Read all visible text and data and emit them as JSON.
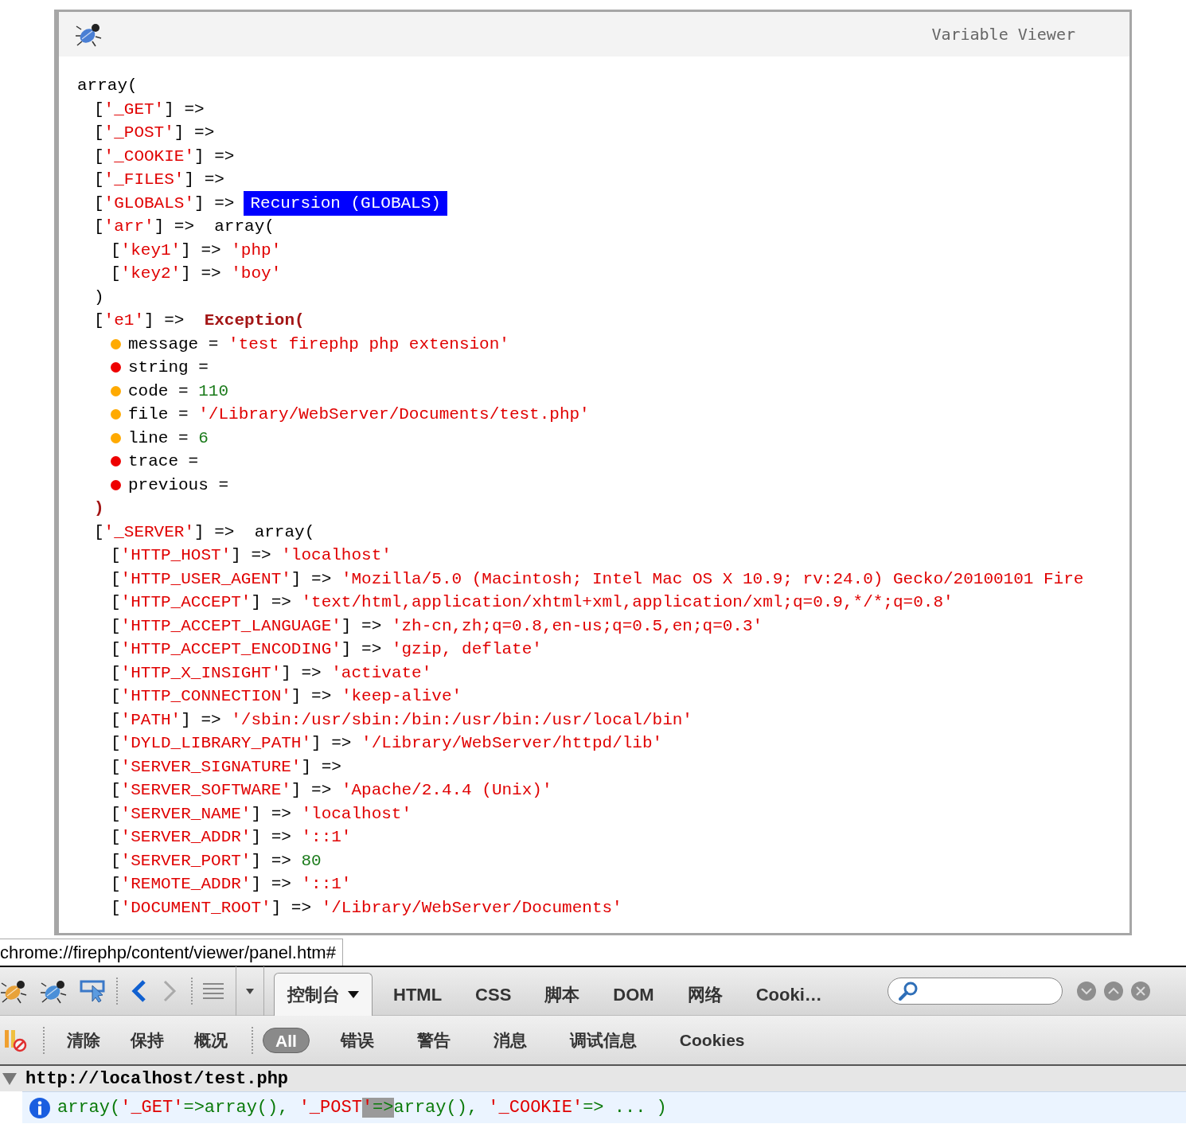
{
  "viewer": {
    "title": "Variable Viewer",
    "tree": {
      "line": [
        {
          "kind": "plain",
          "text": "array("
        }
      ],
      "children": [
        {
          "line": [
            {
              "kind": "plain",
              "text": "["
            },
            {
              "kind": "key",
              "text": "'_GET'"
            },
            {
              "kind": "plain",
              "text": "] =>"
            }
          ]
        },
        {
          "line": [
            {
              "kind": "plain",
              "text": "["
            },
            {
              "kind": "key",
              "text": "'_POST'"
            },
            {
              "kind": "plain",
              "text": "] =>"
            }
          ]
        },
        {
          "line": [
            {
              "kind": "plain",
              "text": "["
            },
            {
              "kind": "key",
              "text": "'_COOKIE'"
            },
            {
              "kind": "plain",
              "text": "] =>"
            }
          ]
        },
        {
          "line": [
            {
              "kind": "plain",
              "text": "["
            },
            {
              "kind": "key",
              "text": "'_FILES'"
            },
            {
              "kind": "plain",
              "text": "] =>"
            }
          ]
        },
        {
          "line": [
            {
              "kind": "plain",
              "text": "["
            },
            {
              "kind": "key",
              "text": "'GLOBALS'"
            },
            {
              "kind": "plain",
              "text": "] =>"
            },
            {
              "kind": "recursion",
              "text": "Recursion (GLOBALS)"
            }
          ]
        },
        {
          "line": [
            {
              "kind": "plain",
              "text": "["
            },
            {
              "kind": "key",
              "text": "'arr'"
            },
            {
              "kind": "plain",
              "text": "] =>  array("
            }
          ],
          "children": [
            {
              "line": [
                {
                  "kind": "plain",
                  "text": "["
                },
                {
                  "kind": "key",
                  "text": "'key1'"
                },
                {
                  "kind": "plain",
                  "text": "] => "
                },
                {
                  "kind": "string",
                  "text": "'php'"
                }
              ]
            },
            {
              "line": [
                {
                  "kind": "plain",
                  "text": "["
                },
                {
                  "kind": "key",
                  "text": "'key2'"
                },
                {
                  "kind": "plain",
                  "text": "] => "
                },
                {
                  "kind": "string",
                  "text": "'boy'"
                }
              ]
            }
          ],
          "close": [
            {
              "kind": "plain",
              "text": ")"
            }
          ]
        },
        {
          "line": [
            {
              "kind": "plain",
              "text": "["
            },
            {
              "kind": "key",
              "text": "'e1'"
            },
            {
              "kind": "plain",
              "text": "] =>  "
            },
            {
              "kind": "exception",
              "text": "Exception("
            }
          ],
          "children": [
            {
              "color": "#ffaa00",
              "line": [
                {
                  "kind": "plain",
                  "text": "message = "
                },
                {
                  "kind": "string",
                  "text": "'test firephp php extension'"
                }
              ]
            },
            {
              "color": "#ee0000",
              "line": [
                {
                  "kind": "plain",
                  "text": "string ="
                }
              ]
            },
            {
              "color": "#ffaa00",
              "line": [
                {
                  "kind": "plain",
                  "text": "code = "
                },
                {
                  "kind": "number",
                  "text": "110"
                }
              ]
            },
            {
              "color": "#ffaa00",
              "line": [
                {
                  "kind": "plain",
                  "text": "file = "
                },
                {
                  "kind": "string",
                  "text": "'/Library/WebServer/Documents/test.php'"
                }
              ]
            },
            {
              "color": "#ffaa00",
              "line": [
                {
                  "kind": "plain",
                  "text": "line = "
                },
                {
                  "kind": "number",
                  "text": "6"
                }
              ]
            },
            {
              "color": "#ee0000",
              "line": [
                {
                  "kind": "plain",
                  "text": "trace ="
                }
              ]
            },
            {
              "color": "#ee0000",
              "line": [
                {
                  "kind": "plain",
                  "text": "previous ="
                }
              ]
            }
          ],
          "close": [
            {
              "kind": "exception",
              "text": ")"
            }
          ]
        },
        {
          "line": [
            {
              "kind": "plain",
              "text": "["
            },
            {
              "kind": "key",
              "text": "'_SERVER'"
            },
            {
              "kind": "plain",
              "text": "] =>  array("
            }
          ],
          "children": [
            {
              "line": [
                {
                  "kind": "plain",
                  "text": "["
                },
                {
                  "kind": "key",
                  "text": "'HTTP_HOST'"
                },
                {
                  "kind": "plain",
                  "text": "] => "
                },
                {
                  "kind": "string",
                  "text": "'localhost'"
                }
              ]
            },
            {
              "line": [
                {
                  "kind": "plain",
                  "text": "["
                },
                {
                  "kind": "key",
                  "text": "'HTTP_USER_AGENT'"
                },
                {
                  "kind": "plain",
                  "text": "] => "
                },
                {
                  "kind": "string",
                  "text": "'Mozilla/5.0 (Macintosh; Intel Mac OS X 10.9; rv:24.0) Gecko/20100101 Fire"
                }
              ]
            },
            {
              "line": [
                {
                  "kind": "plain",
                  "text": "["
                },
                {
                  "kind": "key",
                  "text": "'HTTP_ACCEPT'"
                },
                {
                  "kind": "plain",
                  "text": "] => "
                },
                {
                  "kind": "string",
                  "text": "'text/html,application/xhtml+xml,application/xml;q=0.9,*/*;q=0.8'"
                }
              ]
            },
            {
              "line": [
                {
                  "kind": "plain",
                  "text": "["
                },
                {
                  "kind": "key",
                  "text": "'HTTP_ACCEPT_LANGUAGE'"
                },
                {
                  "kind": "plain",
                  "text": "] => "
                },
                {
                  "kind": "string",
                  "text": "'zh-cn,zh;q=0.8,en-us;q=0.5,en;q=0.3'"
                }
              ]
            },
            {
              "line": [
                {
                  "kind": "plain",
                  "text": "["
                },
                {
                  "kind": "key",
                  "text": "'HTTP_ACCEPT_ENCODING'"
                },
                {
                  "kind": "plain",
                  "text": "] => "
                },
                {
                  "kind": "string",
                  "text": "'gzip, deflate'"
                }
              ]
            },
            {
              "line": [
                {
                  "kind": "plain",
                  "text": "["
                },
                {
                  "kind": "key",
                  "text": "'HTTP_X_INSIGHT'"
                },
                {
                  "kind": "plain",
                  "text": "] => "
                },
                {
                  "kind": "string",
                  "text": "'activate'"
                }
              ]
            },
            {
              "line": [
                {
                  "kind": "plain",
                  "text": "["
                },
                {
                  "kind": "key",
                  "text": "'HTTP_CONNECTION'"
                },
                {
                  "kind": "plain",
                  "text": "] => "
                },
                {
                  "kind": "string",
                  "text": "'keep-alive'"
                }
              ]
            },
            {
              "line": [
                {
                  "kind": "plain",
                  "text": "["
                },
                {
                  "kind": "key",
                  "text": "'PATH'"
                },
                {
                  "kind": "plain",
                  "text": "] => "
                },
                {
                  "kind": "string",
                  "text": "'/sbin:/usr/sbin:/bin:/usr/bin:/usr/local/bin'"
                }
              ]
            },
            {
              "line": [
                {
                  "kind": "plain",
                  "text": "["
                },
                {
                  "kind": "key",
                  "text": "'DYLD_LIBRARY_PATH'"
                },
                {
                  "kind": "plain",
                  "text": "] => "
                },
                {
                  "kind": "string",
                  "text": "'/Library/WebServer/httpd/lib'"
                }
              ]
            },
            {
              "line": [
                {
                  "kind": "plain",
                  "text": "["
                },
                {
                  "kind": "key",
                  "text": "'SERVER_SIGNATURE'"
                },
                {
                  "kind": "plain",
                  "text": "] =>"
                }
              ]
            },
            {
              "line": [
                {
                  "kind": "plain",
                  "text": "["
                },
                {
                  "kind": "key",
                  "text": "'SERVER_SOFTWARE'"
                },
                {
                  "kind": "plain",
                  "text": "] => "
                },
                {
                  "kind": "string",
                  "text": "'Apache/2.4.4 (Unix)'"
                }
              ]
            },
            {
              "line": [
                {
                  "kind": "plain",
                  "text": "["
                },
                {
                  "kind": "key",
                  "text": "'SERVER_NAME'"
                },
                {
                  "kind": "plain",
                  "text": "] => "
                },
                {
                  "kind": "string",
                  "text": "'localhost'"
                }
              ]
            },
            {
              "line": [
                {
                  "kind": "plain",
                  "text": "["
                },
                {
                  "kind": "key",
                  "text": "'SERVER_ADDR'"
                },
                {
                  "kind": "plain",
                  "text": "] => "
                },
                {
                  "kind": "string",
                  "text": "'::1'"
                }
              ]
            },
            {
              "line": [
                {
                  "kind": "plain",
                  "text": "["
                },
                {
                  "kind": "key",
                  "text": "'SERVER_PORT'"
                },
                {
                  "kind": "plain",
                  "text": "] => "
                },
                {
                  "kind": "number",
                  "text": "80"
                }
              ]
            },
            {
              "line": [
                {
                  "kind": "plain",
                  "text": "["
                },
                {
                  "kind": "key",
                  "text": "'REMOTE_ADDR'"
                },
                {
                  "kind": "plain",
                  "text": "] => "
                },
                {
                  "kind": "string",
                  "text": "'::1'"
                }
              ]
            },
            {
              "line": [
                {
                  "kind": "plain",
                  "text": "["
                },
                {
                  "kind": "key",
                  "text": "'DOCUMENT_ROOT'"
                },
                {
                  "kind": "plain",
                  "text": "] => "
                },
                {
                  "kind": "string",
                  "text": "'/Library/WebServer/Documents'"
                }
              ]
            }
          ]
        }
      ]
    }
  },
  "status_url": "chrome://firephp/content/viewer/panel.htm#",
  "toolbar": {
    "nav": [
      {
        "kind": "back",
        "disabled": false
      },
      {
        "kind": "forward",
        "disabled": true
      }
    ],
    "tabs": [
      {
        "label": "控制台",
        "selected": true,
        "dropdown": true
      },
      {
        "label": "HTML",
        "selected": false,
        "dropdown": false
      },
      {
        "label": "CSS",
        "selected": false,
        "dropdown": false
      },
      {
        "label": "脚本",
        "selected": false,
        "dropdown": false
      },
      {
        "label": "DOM",
        "selected": false,
        "dropdown": false
      },
      {
        "label": "网络",
        "selected": false,
        "dropdown": false
      },
      {
        "label": "Cooki…",
        "selected": false,
        "dropdown": false
      }
    ]
  },
  "console_toolbar": {
    "actions": [
      "清除",
      "保持",
      "概况"
    ],
    "filters": [
      {
        "label": "All",
        "selected": true
      },
      {
        "label": "错误",
        "selected": false
      },
      {
        "label": "警告",
        "selected": false
      },
      {
        "label": "消息",
        "selected": false
      },
      {
        "label": "调试信息",
        "selected": false
      },
      {
        "label": "Cookies",
        "selected": false
      }
    ]
  },
  "log": {
    "group": {
      "url": "http://localhost/test.php",
      "expanded": true
    },
    "entry": {
      "kind": "info",
      "tokens": [
        {
          "kind": "code",
          "text": "array(",
          "selected": false
        },
        {
          "kind": "string",
          "text": "'_GET'",
          "selected": false
        },
        {
          "kind": "code",
          "text": "=>array(), ",
          "selected": false
        },
        {
          "kind": "string",
          "text": "'_POST",
          "selected": false
        },
        {
          "kind": "string",
          "text": "'",
          "selected": true
        },
        {
          "kind": "code",
          "text": "=>",
          "selected": true
        },
        {
          "kind": "code",
          "text": "array(), ",
          "selected": false
        },
        {
          "kind": "string",
          "text": "'_COOKIE'",
          "selected": false
        },
        {
          "kind": "code",
          "text": "=> ... )",
          "selected": false
        }
      ]
    }
  }
}
